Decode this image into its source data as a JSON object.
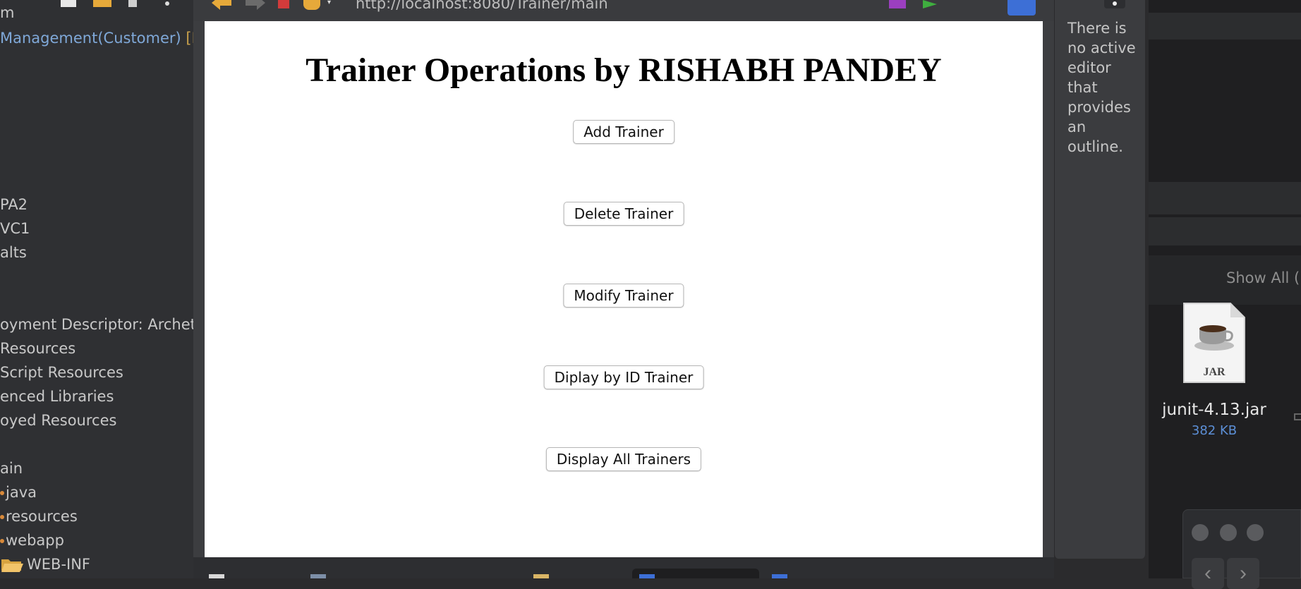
{
  "explorer": {
    "items": [
      {
        "text": "m"
      },
      {
        "text": "Management(Customer)",
        "tag": "[F"
      },
      {
        "text": "PA2"
      },
      {
        "text": "VC1"
      },
      {
        "text": "alts"
      },
      {
        "text": "oyment Descriptor: Archety"
      },
      {
        "text": "Resources"
      },
      {
        "text": "Script Resources"
      },
      {
        "text": "enced Libraries"
      },
      {
        "text": "oyed Resources"
      },
      {
        "text": "ain"
      },
      {
        "text": "java"
      },
      {
        "text": "resources"
      },
      {
        "text": "webapp"
      },
      {
        "text": "WEB-INF"
      }
    ]
  },
  "browser": {
    "url": "http://localhost:8080/Trainer/main",
    "page_title": "Trainer Operations by RISHABH PANDEY",
    "buttons": {
      "add": "Add Trainer",
      "delete": "Delete Trainer",
      "modify": "Modify Trainer",
      "display_by_id": "Diplay by ID Trainer",
      "display_all": "Display All Trainers"
    }
  },
  "outline": {
    "message": "There is no active editor that provides an outline."
  },
  "finder": {
    "show_all": "Show All (",
    "file_name": "junit-4.13.jar",
    "file_size": "382 KB",
    "file_icon_label": "JAR"
  },
  "colors": {
    "ide_bg": "#2f3033",
    "page_bg": "#ffffff",
    "link_blue": "#5c8fd6"
  }
}
